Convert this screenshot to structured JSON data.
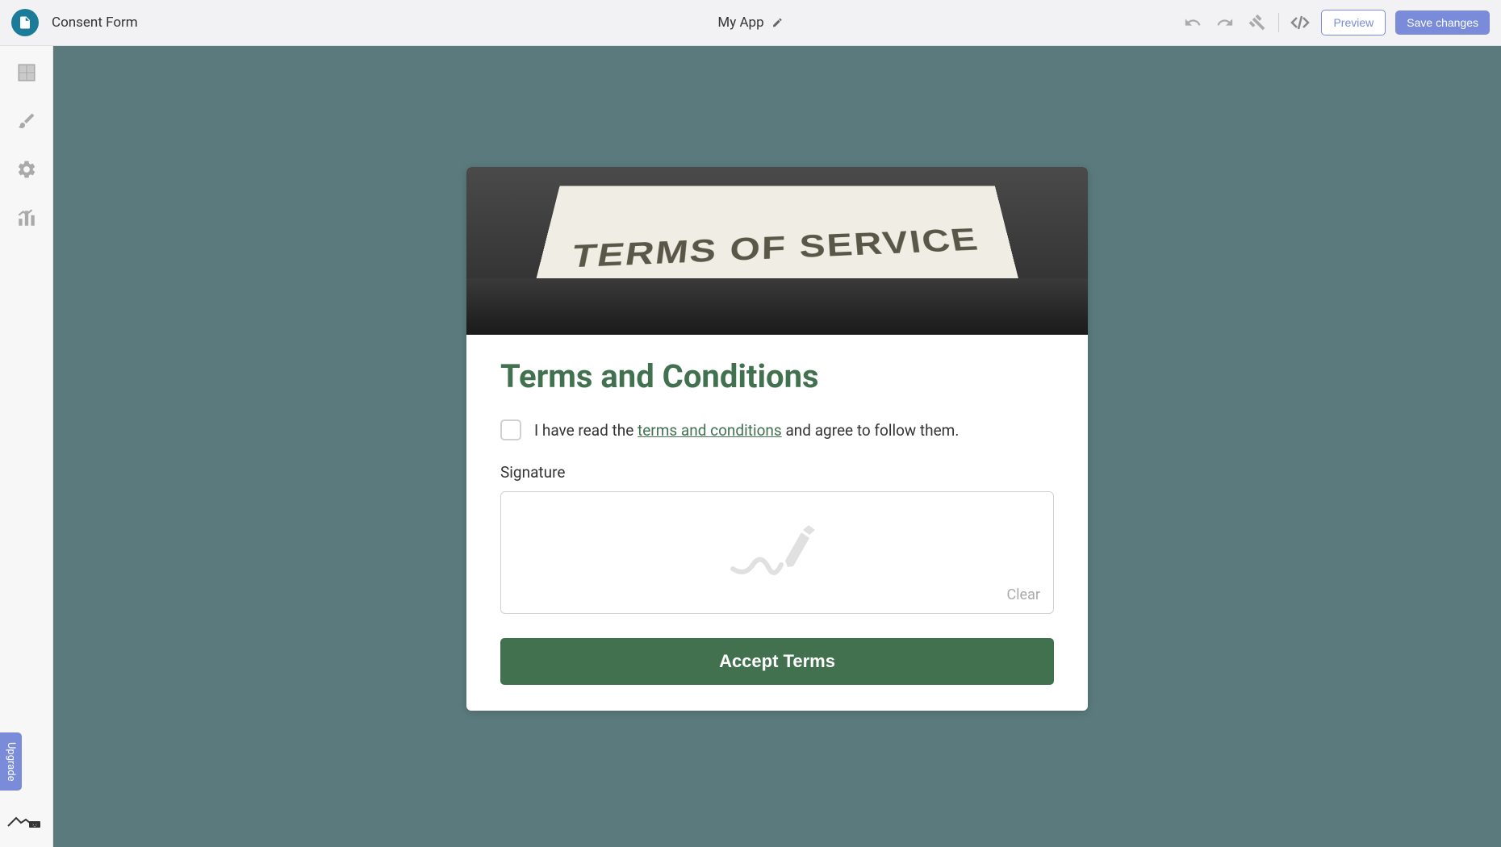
{
  "header": {
    "pageName": "Consent Form",
    "appTitle": "My App",
    "previewLabel": "Preview",
    "saveLabel": "Save changes"
  },
  "sidebar": {
    "upgradeLabel": "Upgrade"
  },
  "form": {
    "heroText": "TERMS OF SERVICE",
    "title": "Terms and Conditions",
    "consentPrefix": "I have read the ",
    "consentLink": "terms and conditions",
    "consentSuffix": " and agree to follow them.",
    "signatureLabel": "Signature",
    "clearLabel": "Clear",
    "acceptLabel": "Accept Terms"
  },
  "colors": {
    "accent": "#42714f",
    "primaryButton": "#7a8bd9",
    "canvas": "#5a7a7d"
  }
}
